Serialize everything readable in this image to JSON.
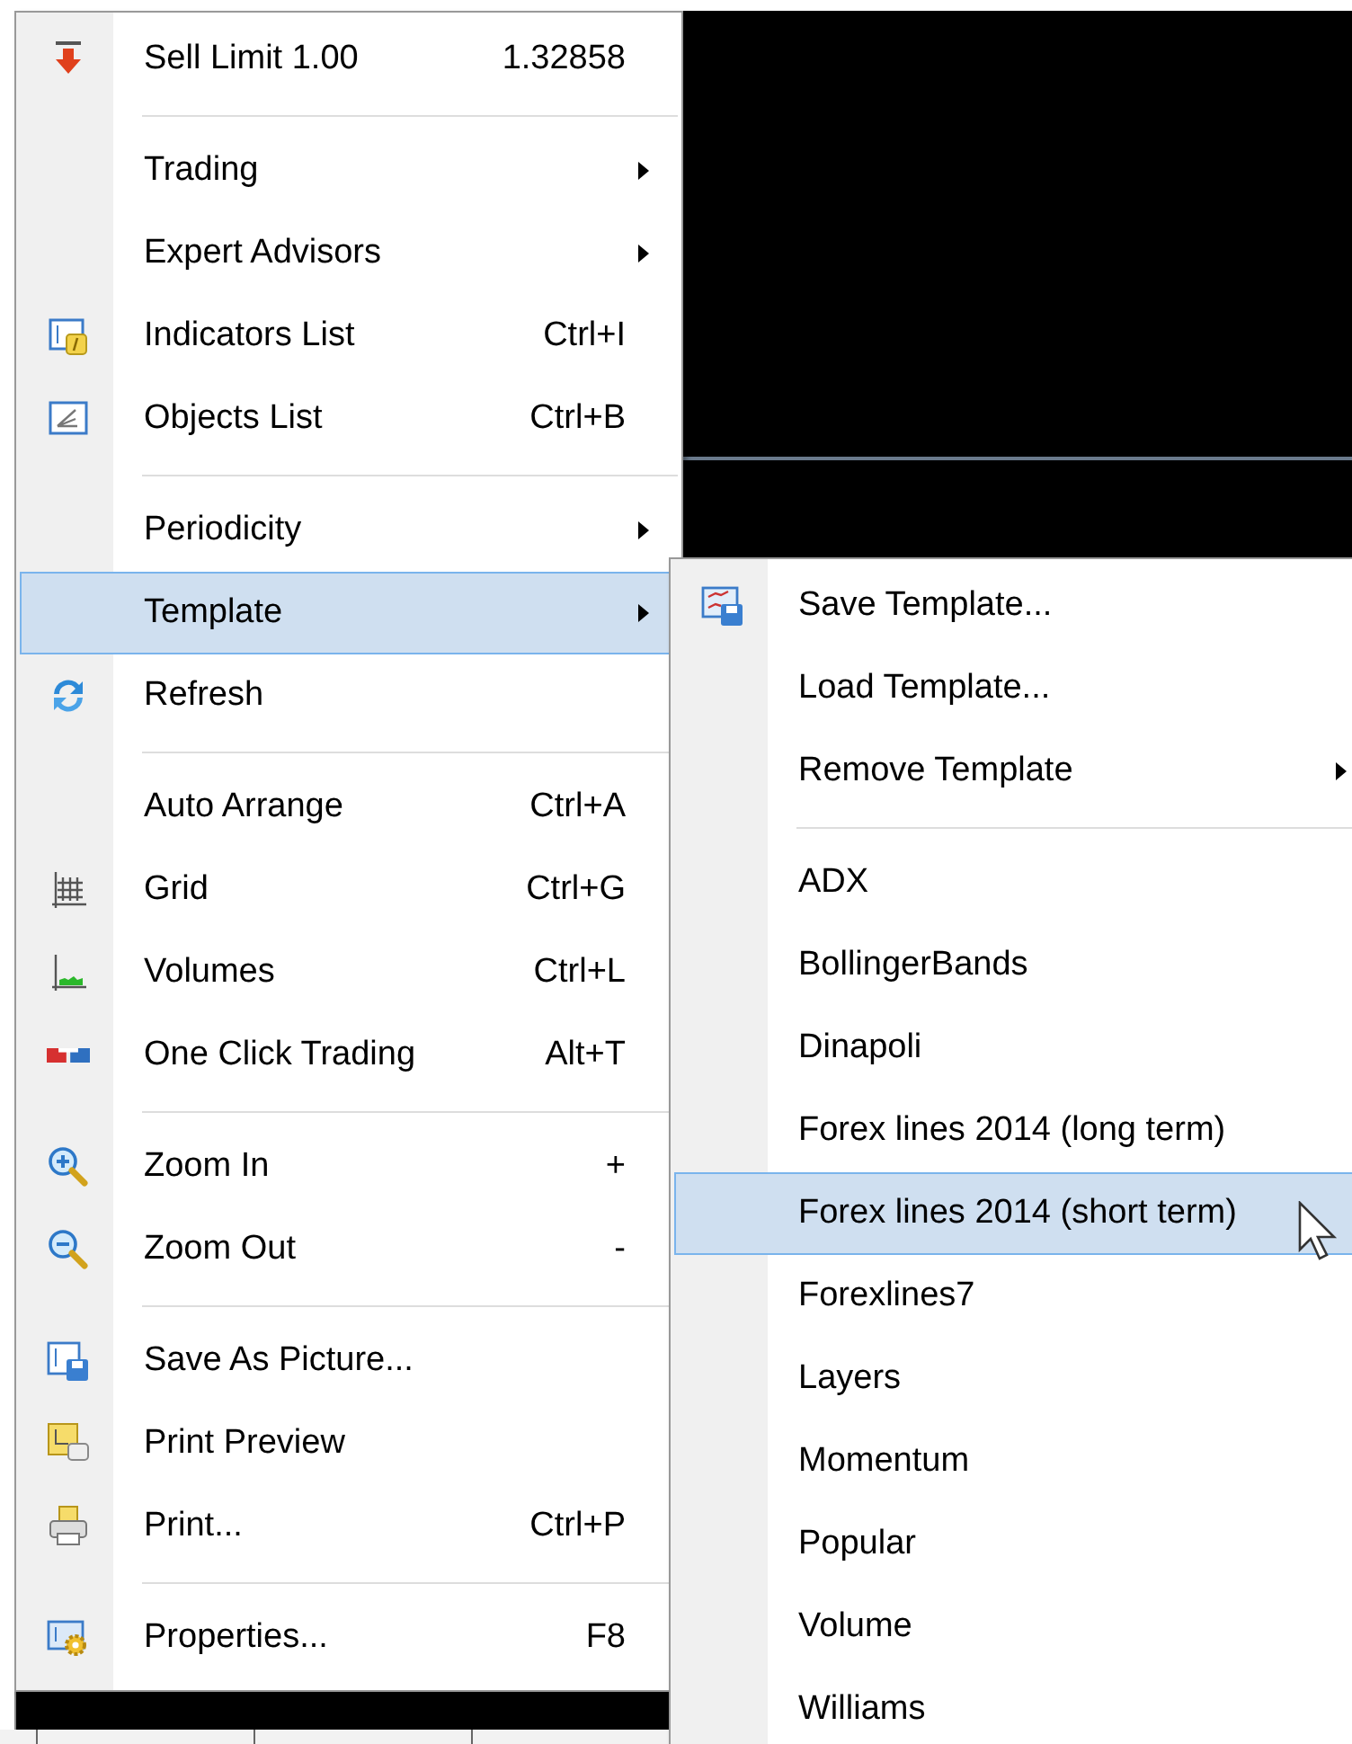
{
  "menu": {
    "items": [
      {
        "kind": "item",
        "label": "Sell Limit 1.00",
        "right_text": "1.32858",
        "submenu": false,
        "selected": false
      },
      {
        "kind": "separator"
      },
      {
        "kind": "item",
        "label": "Trading",
        "submenu": true,
        "selected": false
      },
      {
        "kind": "item",
        "label": "Expert Advisors",
        "submenu": true,
        "selected": false
      },
      {
        "kind": "item",
        "label": "Indicators List",
        "right_text": "Ctrl+I",
        "submenu": false,
        "selected": false
      },
      {
        "kind": "item",
        "label": "Objects List",
        "right_text": "Ctrl+B",
        "submenu": false,
        "selected": false
      },
      {
        "kind": "separator"
      },
      {
        "kind": "item",
        "label": "Periodicity",
        "submenu": true,
        "selected": false
      },
      {
        "kind": "item",
        "label": "Template",
        "submenu": true,
        "selected": true
      },
      {
        "kind": "item",
        "label": "Refresh",
        "submenu": false,
        "selected": false
      },
      {
        "kind": "separator"
      },
      {
        "kind": "item",
        "label": "Auto Arrange",
        "right_text": "Ctrl+A",
        "submenu": false,
        "selected": false
      },
      {
        "kind": "item",
        "label": "Grid",
        "right_text": "Ctrl+G",
        "submenu": false,
        "selected": false
      },
      {
        "kind": "item",
        "label": "Volumes",
        "right_text": "Ctrl+L",
        "submenu": false,
        "selected": false
      },
      {
        "kind": "item",
        "label": "One Click Trading",
        "right_text": "Alt+T",
        "submenu": false,
        "selected": false
      },
      {
        "kind": "separator"
      },
      {
        "kind": "item",
        "label": "Zoom In",
        "right_text": "+",
        "submenu": false,
        "selected": false
      },
      {
        "kind": "item",
        "label": "Zoom Out",
        "right_text": "-",
        "submenu": false,
        "selected": false
      },
      {
        "kind": "separator"
      },
      {
        "kind": "item",
        "label": "Save As Picture...",
        "submenu": false,
        "selected": false
      },
      {
        "kind": "item",
        "label": "Print Preview",
        "submenu": false,
        "selected": false
      },
      {
        "kind": "item",
        "label": "Print...",
        "right_text": "Ctrl+P",
        "submenu": false,
        "selected": false
      },
      {
        "kind": "separator"
      },
      {
        "kind": "item",
        "label": "Properties...",
        "right_text": "F8",
        "submenu": false,
        "selected": false
      }
    ]
  },
  "template_submenu": {
    "items": [
      {
        "kind": "item",
        "label": "Save Template...",
        "submenu": false,
        "selected": false
      },
      {
        "kind": "item",
        "label": "Load Template...",
        "submenu": false,
        "selected": false
      },
      {
        "kind": "item",
        "label": "Remove Template",
        "submenu": true,
        "selected": false
      },
      {
        "kind": "separator"
      },
      {
        "kind": "item",
        "label": "ADX",
        "submenu": false,
        "selected": false
      },
      {
        "kind": "item",
        "label": "BollingerBands",
        "submenu": false,
        "selected": false
      },
      {
        "kind": "item",
        "label": "Dinapoli",
        "submenu": false,
        "selected": false
      },
      {
        "kind": "item",
        "label": "Forex lines 2014 (long term)",
        "submenu": false,
        "selected": false
      },
      {
        "kind": "item",
        "label": "Forex lines 2014 (short term)",
        "submenu": false,
        "selected": true
      },
      {
        "kind": "item",
        "label": "Forexlines7",
        "submenu": false,
        "selected": false
      },
      {
        "kind": "item",
        "label": "Layers",
        "submenu": false,
        "selected": false
      },
      {
        "kind": "item",
        "label": "Momentum",
        "submenu": false,
        "selected": false
      },
      {
        "kind": "item",
        "label": "Popular",
        "submenu": false,
        "selected": false
      },
      {
        "kind": "item",
        "label": "Volume",
        "submenu": false,
        "selected": false
      },
      {
        "kind": "item",
        "label": "Williams",
        "submenu": false,
        "selected": false
      }
    ]
  }
}
